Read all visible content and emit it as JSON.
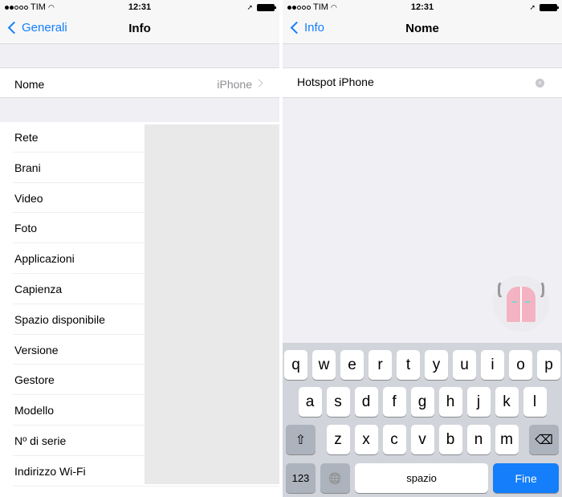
{
  "status_bar": {
    "carrier": "TIM",
    "time": "12:31",
    "signal_bars": 2,
    "signal_max": 5
  },
  "left_screen": {
    "nav": {
      "back_label": "Generali",
      "title": "Info"
    },
    "nome_row": {
      "label": "Nome",
      "value": "iPhone"
    },
    "items": [
      {
        "label": "Rete"
      },
      {
        "label": "Brani"
      },
      {
        "label": "Video"
      },
      {
        "label": "Foto"
      },
      {
        "label": "Applicazioni"
      },
      {
        "label": "Capienza"
      },
      {
        "label": "Spazio disponibile"
      },
      {
        "label": "Versione"
      },
      {
        "label": "Gestore"
      },
      {
        "label": "Modello"
      },
      {
        "label": "Nº di serie"
      },
      {
        "label": "Indirizzo Wi-Fi"
      }
    ]
  },
  "right_screen": {
    "nav": {
      "back_label": "Info",
      "title": "Nome"
    },
    "name_field": {
      "value": "Hotspot iPhone"
    },
    "keyboard": {
      "row1": [
        "q",
        "w",
        "e",
        "r",
        "t",
        "y",
        "u",
        "i",
        "o",
        "p"
      ],
      "row2": [
        "a",
        "s",
        "d",
        "f",
        "g",
        "h",
        "j",
        "k",
        "l"
      ],
      "row3": [
        "z",
        "x",
        "c",
        "v",
        "b",
        "n",
        "m"
      ],
      "shift_icon": "⇧",
      "delete_icon": "⌫",
      "numbers_label": "123",
      "globe_icon": "🌐",
      "space_label": "spazio",
      "done_label": "Fine"
    }
  },
  "colors": {
    "accent": "#147efb",
    "background": "#efeff4",
    "keyboard_bg": "#d1d4da"
  }
}
